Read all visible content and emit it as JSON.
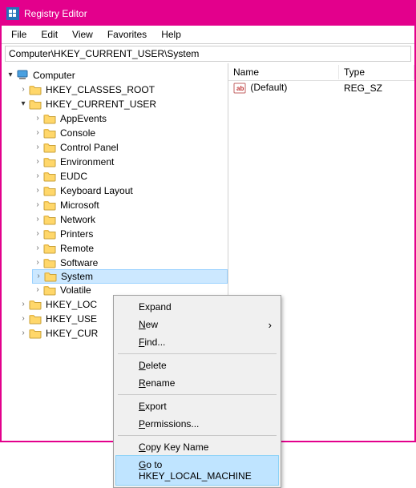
{
  "window": {
    "title": "Registry Editor"
  },
  "menubar": [
    "File",
    "Edit",
    "View",
    "Favorites",
    "Help"
  ],
  "address": "Computer\\HKEY_CURRENT_USER\\System",
  "tree": {
    "root": "Computer",
    "hives": [
      {
        "name": "HKEY_CLASSES_ROOT",
        "expanded": false,
        "children": []
      },
      {
        "name": "HKEY_CURRENT_USER",
        "expanded": true,
        "children": [
          "AppEvents",
          "Console",
          "Control Panel",
          "Environment",
          "EUDC",
          "Keyboard Layout",
          "Microsoft",
          "Network",
          "Printers",
          "Remote",
          "Software",
          "System",
          "Volatile"
        ],
        "selected_child": "System"
      },
      {
        "name": "HKEY_LOC",
        "expanded": false
      },
      {
        "name": "HKEY_USE",
        "expanded": false
      },
      {
        "name": "HKEY_CUR",
        "expanded": false
      }
    ]
  },
  "list": {
    "columns": [
      "Name",
      "Type"
    ],
    "rows": [
      {
        "name": "(Default)",
        "type": "REG_SZ"
      }
    ]
  },
  "context_menu": {
    "items": [
      {
        "label": "Expand",
        "type": "item"
      },
      {
        "label": "New",
        "type": "submenu",
        "accel": "N"
      },
      {
        "label": "Find...",
        "type": "item",
        "accel": "F"
      },
      {
        "type": "sep"
      },
      {
        "label": "Delete",
        "type": "item",
        "accel": "D"
      },
      {
        "label": "Rename",
        "type": "item",
        "accel": "R"
      },
      {
        "type": "sep"
      },
      {
        "label": "Export",
        "type": "item",
        "accel": "E"
      },
      {
        "label": "Permissions...",
        "type": "item",
        "accel": "P"
      },
      {
        "type": "sep"
      },
      {
        "label": "Copy Key Name",
        "type": "item",
        "accel": "C"
      },
      {
        "label": "Go to HKEY_LOCAL_MACHINE",
        "type": "item",
        "highlighted": true,
        "accel_pos": 0
      }
    ]
  }
}
